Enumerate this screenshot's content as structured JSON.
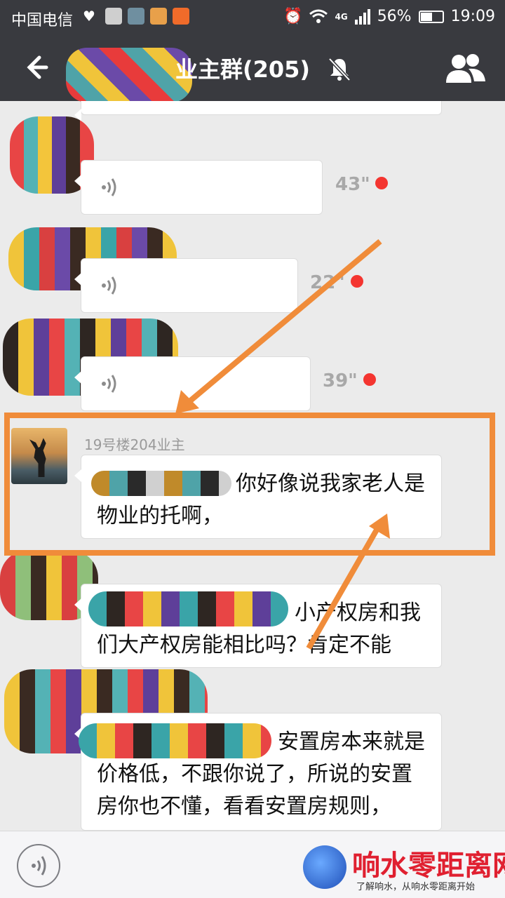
{
  "status_bar": {
    "carrier": "中国电信",
    "network": "4G",
    "battery": "56%",
    "battery_level": 0.56,
    "time": "19:09"
  },
  "title_bar": {
    "title": "业主群(205)",
    "back_icon": "back-arrow-icon",
    "mute_icon": "bell-muted-icon",
    "members_icon": "group-members-icon"
  },
  "messages": [
    {
      "type": "voice",
      "duration": "43\"",
      "unread": true
    },
    {
      "type": "voice",
      "duration": "22\"",
      "unread": true
    },
    {
      "type": "voice",
      "duration": "39\"",
      "unread": true
    },
    {
      "type": "text",
      "sender": "19号楼204业主",
      "text": "你好像说我家老人是物业的托啊，"
    },
    {
      "type": "text",
      "text": "小产权房和我们大产权房能相比吗？肯定不能"
    },
    {
      "type": "text",
      "text": "安置房本来就是价格低，不跟你说了，所说的安置房你也不懂，看看安置房规则，"
    }
  ],
  "bottom_bar": {
    "voice_toggle_icon": "voice-input-icon"
  },
  "watermark": {
    "name": "响水零距离网",
    "slogan": "了解响水，从响水零距离开始"
  },
  "colors": {
    "header": "#393a3f",
    "chat_bg": "#ebebeb",
    "unread": "#f43530",
    "annotation": "#f08c3a"
  }
}
